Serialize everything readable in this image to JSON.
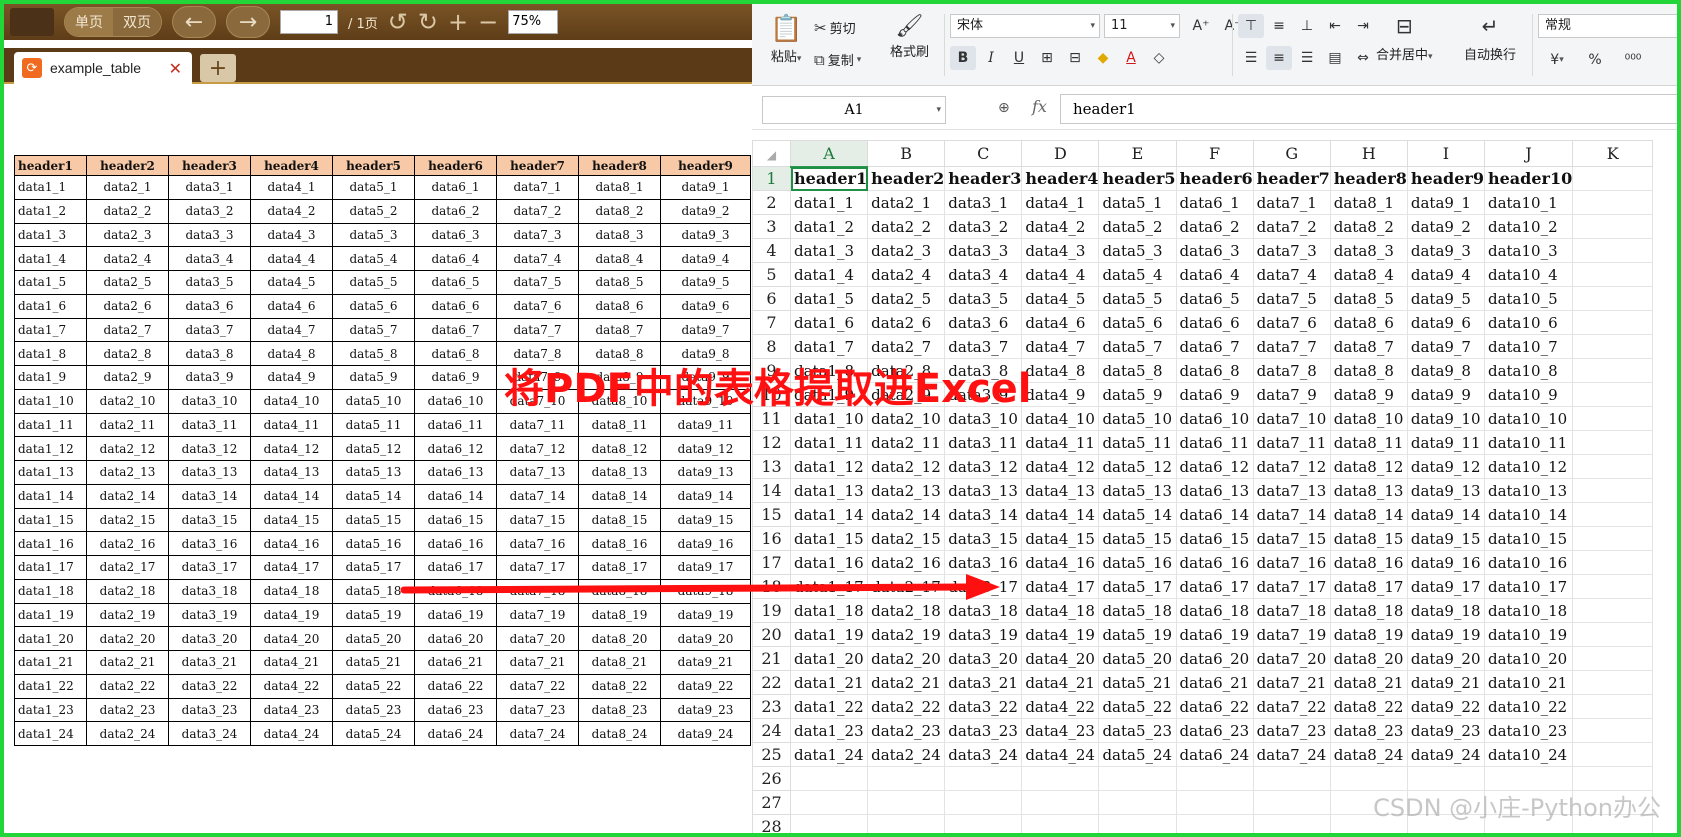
{
  "pdf_viewer": {
    "toolbar": {
      "single_page": "单页",
      "double_page": "双页",
      "page_number": "1",
      "page_total": "/ 1页",
      "zoom": "75%"
    },
    "tab": {
      "file_name": "example_table",
      "close": "✕",
      "add": "+"
    },
    "table": {
      "headers": [
        "header1",
        "header2",
        "header3",
        "header4",
        "header5",
        "header6",
        "header7",
        "header8",
        "header9"
      ],
      "rows": [
        [
          "data1_1",
          "data2_1",
          "data3_1",
          "data4_1",
          "data5_1",
          "data6_1",
          "data7_1",
          "data8_1",
          "data9_1"
        ],
        [
          "data1_2",
          "data2_2",
          "data3_2",
          "data4_2",
          "data5_2",
          "data6_2",
          "data7_2",
          "data8_2",
          "data9_2"
        ],
        [
          "data1_3",
          "data2_3",
          "data3_3",
          "data4_3",
          "data5_3",
          "data6_3",
          "data7_3",
          "data8_3",
          "data9_3"
        ],
        [
          "data1_4",
          "data2_4",
          "data3_4",
          "data4_4",
          "data5_4",
          "data6_4",
          "data7_4",
          "data8_4",
          "data9_4"
        ],
        [
          "data1_5",
          "data2_5",
          "data3_5",
          "data4_5",
          "data5_5",
          "data6_5",
          "data7_5",
          "data8_5",
          "data9_5"
        ],
        [
          "data1_6",
          "data2_6",
          "data3_6",
          "data4_6",
          "data5_6",
          "data6_6",
          "data7_6",
          "data8_6",
          "data9_6"
        ],
        [
          "data1_7",
          "data2_7",
          "data3_7",
          "data4_7",
          "data5_7",
          "data6_7",
          "data7_7",
          "data8_7",
          "data9_7"
        ],
        [
          "data1_8",
          "data2_8",
          "data3_8",
          "data4_8",
          "data5_8",
          "data6_8",
          "data7_8",
          "data8_8",
          "data9_8"
        ],
        [
          "data1_9",
          "data2_9",
          "data3_9",
          "data4_9",
          "data5_9",
          "data6_9",
          "data7_9",
          "data8_9",
          "data9_9"
        ],
        [
          "data1_10",
          "data2_10",
          "data3_10",
          "data4_10",
          "data5_10",
          "data6_10",
          "data7_10",
          "data8_10",
          "data9_10"
        ],
        [
          "data1_11",
          "data2_11",
          "data3_11",
          "data4_11",
          "data5_11",
          "data6_11",
          "data7_11",
          "data8_11",
          "data9_11"
        ],
        [
          "data1_12",
          "data2_12",
          "data3_12",
          "data4_12",
          "data5_12",
          "data6_12",
          "data7_12",
          "data8_12",
          "data9_12"
        ],
        [
          "data1_13",
          "data2_13",
          "data3_13",
          "data4_13",
          "data5_13",
          "data6_13",
          "data7_13",
          "data8_13",
          "data9_13"
        ],
        [
          "data1_14",
          "data2_14",
          "data3_14",
          "data4_14",
          "data5_14",
          "data6_14",
          "data7_14",
          "data8_14",
          "data9_14"
        ],
        [
          "data1_15",
          "data2_15",
          "data3_15",
          "data4_15",
          "data5_15",
          "data6_15",
          "data7_15",
          "data8_15",
          "data9_15"
        ],
        [
          "data1_16",
          "data2_16",
          "data3_16",
          "data4_16",
          "data5_16",
          "data6_16",
          "data7_16",
          "data8_16",
          "data9_16"
        ],
        [
          "data1_17",
          "data2_17",
          "data3_17",
          "data4_17",
          "data5_17",
          "data6_17",
          "data7_17",
          "data8_17",
          "data9_17"
        ],
        [
          "data1_18",
          "data2_18",
          "data3_18",
          "data4_18",
          "data5_18",
          "data6_18",
          "data7_18",
          "data8_18",
          "data9_18"
        ],
        [
          "data1_19",
          "data2_19",
          "data3_19",
          "data4_19",
          "data5_19",
          "data6_19",
          "data7_19",
          "data8_19",
          "data9_19"
        ],
        [
          "data1_20",
          "data2_20",
          "data3_20",
          "data4_20",
          "data5_20",
          "data6_20",
          "data7_20",
          "data8_20",
          "data9_20"
        ],
        [
          "data1_21",
          "data2_21",
          "data3_21",
          "data4_21",
          "data5_21",
          "data6_21",
          "data7_21",
          "data8_21",
          "data9_21"
        ],
        [
          "data1_22",
          "data2_22",
          "data3_22",
          "data4_22",
          "data5_22",
          "data6_22",
          "data7_22",
          "data8_22",
          "data9_22"
        ],
        [
          "data1_23",
          "data2_23",
          "data3_23",
          "data4_23",
          "data5_23",
          "data6_23",
          "data7_23",
          "data8_23",
          "data9_23"
        ],
        [
          "data1_24",
          "data2_24",
          "data3_24",
          "data4_24",
          "data5_24",
          "data6_24",
          "data7_24",
          "data8_24",
          "data9_24"
        ]
      ]
    }
  },
  "spreadsheet": {
    "ribbon": {
      "paste": "粘贴",
      "cut": "剪切",
      "copy": "复制",
      "format_painter": "格式刷",
      "font_name": "宋体",
      "font_size": "11",
      "merge_center": "合并居中",
      "wrap_text": "自动换行",
      "number_format": "常规",
      "currency": "¥",
      "percent": "%"
    },
    "name_box": "A1",
    "fx_label": "fx",
    "formula_value": "header1",
    "column_headers": [
      "A",
      "B",
      "C",
      "D",
      "E",
      "F",
      "G",
      "H",
      "I",
      "J",
      "K"
    ],
    "row_numbers": [
      "1",
      "2",
      "3",
      "4",
      "5",
      "6",
      "7",
      "8",
      "9",
      "10",
      "11",
      "12",
      "13",
      "14",
      "15",
      "16",
      "17",
      "18",
      "19",
      "20",
      "21",
      "22",
      "23",
      "24",
      "25",
      "26",
      "27",
      "28"
    ],
    "header_row": [
      "header1",
      "header2",
      "header3",
      "header4",
      "header5",
      "header6",
      "header7",
      "header8",
      "header9",
      "header10",
      ""
    ],
    "data_rows": [
      [
        "data1_1",
        "data2_1",
        "data3_1",
        "data4_1",
        "data5_1",
        "data6_1",
        "data7_1",
        "data8_1",
        "data9_1",
        "data10_1",
        ""
      ],
      [
        "data1_2",
        "data2_2",
        "data3_2",
        "data4_2",
        "data5_2",
        "data6_2",
        "data7_2",
        "data8_2",
        "data9_2",
        "data10_2",
        ""
      ],
      [
        "data1_3",
        "data2_3",
        "data3_3",
        "data4_3",
        "data5_3",
        "data6_3",
        "data7_3",
        "data8_3",
        "data9_3",
        "data10_3",
        ""
      ],
      [
        "data1_4",
        "data2_4",
        "data3_4",
        "data4_4",
        "data5_4",
        "data6_4",
        "data7_4",
        "data8_4",
        "data9_4",
        "data10_4",
        ""
      ],
      [
        "data1_5",
        "data2_5",
        "data3_5",
        "data4_5",
        "data5_5",
        "data6_5",
        "data7_5",
        "data8_5",
        "data9_5",
        "data10_5",
        ""
      ],
      [
        "data1_6",
        "data2_6",
        "data3_6",
        "data4_6",
        "data5_6",
        "data6_6",
        "data7_6",
        "data8_6",
        "data9_6",
        "data10_6",
        ""
      ],
      [
        "data1_7",
        "data2_7",
        "data3_7",
        "data4_7",
        "data5_7",
        "data6_7",
        "data7_7",
        "data8_7",
        "data9_7",
        "data10_7",
        ""
      ],
      [
        "data1_8",
        "data2_8",
        "data3_8",
        "data4_8",
        "data5_8",
        "data6_8",
        "data7_8",
        "data8_8",
        "data9_8",
        "data10_8",
        ""
      ],
      [
        "data1_9",
        "data2_9",
        "data3_9",
        "data4_9",
        "data5_9",
        "data6_9",
        "data7_9",
        "data8_9",
        "data9_9",
        "data10_9",
        ""
      ],
      [
        "data1_10",
        "data2_10",
        "data3_10",
        "data4_10",
        "data5_10",
        "data6_10",
        "data7_10",
        "data8_10",
        "data9_10",
        "data10_10",
        ""
      ],
      [
        "data1_11",
        "data2_11",
        "data3_11",
        "data4_11",
        "data5_11",
        "data6_11",
        "data7_11",
        "data8_11",
        "data9_11",
        "data10_11",
        ""
      ],
      [
        "data1_12",
        "data2_12",
        "data3_12",
        "data4_12",
        "data5_12",
        "data6_12",
        "data7_12",
        "data8_12",
        "data9_12",
        "data10_12",
        ""
      ],
      [
        "data1_13",
        "data2_13",
        "data3_13",
        "data4_13",
        "data5_13",
        "data6_13",
        "data7_13",
        "data8_13",
        "data9_13",
        "data10_13",
        ""
      ],
      [
        "data1_14",
        "data2_14",
        "data3_14",
        "data4_14",
        "data5_14",
        "data6_14",
        "data7_14",
        "data8_14",
        "data9_14",
        "data10_14",
        ""
      ],
      [
        "data1_15",
        "data2_15",
        "data3_15",
        "data4_15",
        "data5_15",
        "data6_15",
        "data7_15",
        "data8_15",
        "data9_15",
        "data10_15",
        ""
      ],
      [
        "data1_16",
        "data2_16",
        "data3_16",
        "data4_16",
        "data5_16",
        "data6_16",
        "data7_16",
        "data8_16",
        "data9_16",
        "data10_16",
        ""
      ],
      [
        "data1_17",
        "data2_17",
        "data3_17",
        "data4_17",
        "data5_17",
        "data6_17",
        "data7_17",
        "data8_17",
        "data9_17",
        "data10_17",
        ""
      ],
      [
        "data1_18",
        "data2_18",
        "data3_18",
        "data4_18",
        "data5_18",
        "data6_18",
        "data7_18",
        "data8_18",
        "data9_18",
        "data10_18",
        ""
      ],
      [
        "data1_19",
        "data2_19",
        "data3_19",
        "data4_19",
        "data5_19",
        "data6_19",
        "data7_19",
        "data8_19",
        "data9_19",
        "data10_19",
        ""
      ],
      [
        "data1_20",
        "data2_20",
        "data3_20",
        "data4_20",
        "data5_20",
        "data6_20",
        "data7_20",
        "data8_20",
        "data9_20",
        "data10_20",
        ""
      ],
      [
        "data1_21",
        "data2_21",
        "data3_21",
        "data4_21",
        "data5_21",
        "data6_21",
        "data7_21",
        "data8_21",
        "data9_21",
        "data10_21",
        ""
      ],
      [
        "data1_22",
        "data2_22",
        "data3_22",
        "data4_22",
        "data5_22",
        "data6_22",
        "data7_22",
        "data8_22",
        "data9_22",
        "data10_22",
        ""
      ],
      [
        "data1_23",
        "data2_23",
        "data3_23",
        "data4_23",
        "data5_23",
        "data6_23",
        "data7_23",
        "data8_23",
        "data9_23",
        "data10_23",
        ""
      ],
      [
        "data1_24",
        "data2_24",
        "data3_24",
        "data4_24",
        "data5_24",
        "data6_24",
        "data7_24",
        "data8_24",
        "data9_24",
        "data10_24",
        ""
      ]
    ]
  },
  "overlay": {
    "title": "将PDF中的表格提取进Excel",
    "arrow_color": "#ff1010",
    "watermark": "CSDN @小庄-Python办公"
  },
  "colors": {
    "frame": "#22d63a",
    "pdf_toolbar": "#6b4a20",
    "pdf_header_fill": "#f8c9a6",
    "active_cell": "#1f8f46"
  }
}
